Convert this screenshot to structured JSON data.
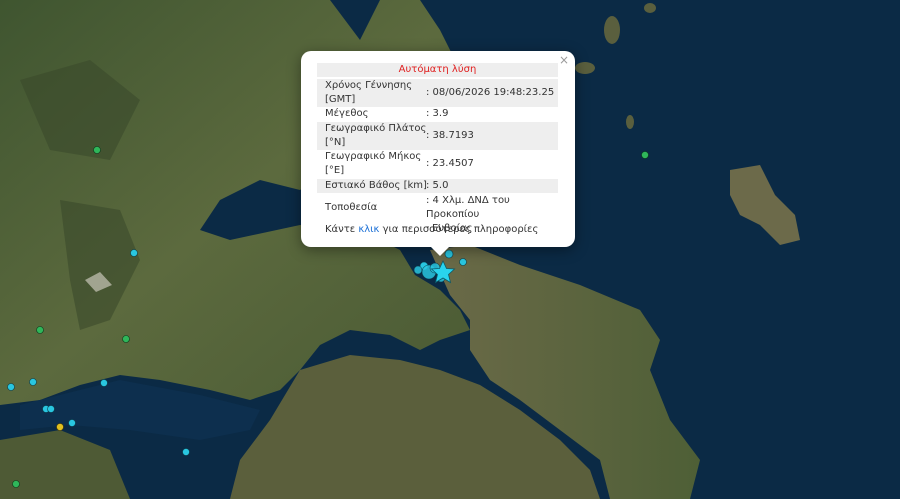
{
  "popup": {
    "title": "Αυτόματη λύση",
    "close_label": "×",
    "rows": [
      {
        "label_line1": "Χρόνος Γέννησης",
        "label_line2": "[GMT]",
        "value": ": 08/06/2026 19:48:23.25"
      },
      {
        "label": "Μέγεθος",
        "value": ": 3.9"
      },
      {
        "label_line1": "Γεωγραφικό Πλάτος",
        "label_line2": "[°N]",
        "value": ": 38.7193"
      },
      {
        "label_line1": "Γεωγραφικό Μήκος",
        "label_line2": "[°E]",
        "value": ": 23.4507"
      },
      {
        "label": "Εστιακό Βάθος [km]",
        "value": ": 5.0"
      },
      {
        "label": "Τοποθεσία",
        "value_line1": ": 4 Χλμ. ΔΝΔ του Προκοπίου",
        "value_line2": "Ευβοίας"
      }
    ],
    "more_prefix": "Κάντε ",
    "more_link": "κλικ",
    "more_suffix": " για περισσότερες πληροφορίες"
  },
  "colors": {
    "title_red": "#e02020",
    "link_blue": "#1a6fd6",
    "sea": "#0b2a45",
    "land": "#4a5a34",
    "marker_cyan": "#29c6e0",
    "marker_green": "#2fb65a",
    "marker_yellow": "#e0c020"
  },
  "icons": {
    "epicenter": "star-icon",
    "close": "close-icon"
  }
}
